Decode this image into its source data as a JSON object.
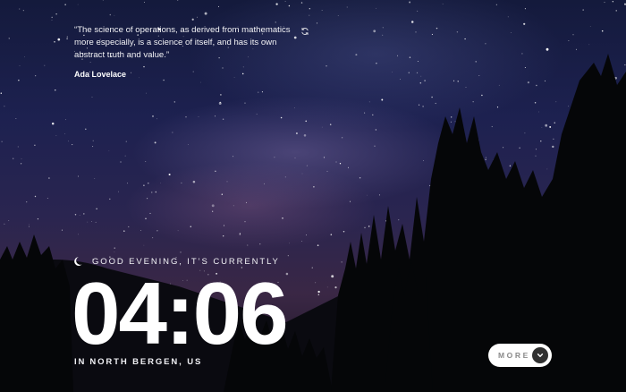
{
  "quote": {
    "text": "“The science of operations, as derived from mathematics more especially, is a science of itself, and has its own abstract truth and value.”",
    "author": "Ada Lovelace"
  },
  "icons": {
    "refresh": "refresh-icon",
    "greeting": "moon-icon",
    "more": "chevron-down-icon"
  },
  "greeting": {
    "text": "GOOD EVENING, IT’S CURRENTLY"
  },
  "clock": {
    "time": "04:06"
  },
  "location": {
    "prefix": "IN",
    "place": "NORTH BERGEN, US"
  },
  "more_button": {
    "label": "MORE"
  },
  "colors": {
    "text": "#ffffff",
    "button_bg": "#ffffff",
    "button_circle": "#303030",
    "button_label": "#8a8a8a"
  }
}
